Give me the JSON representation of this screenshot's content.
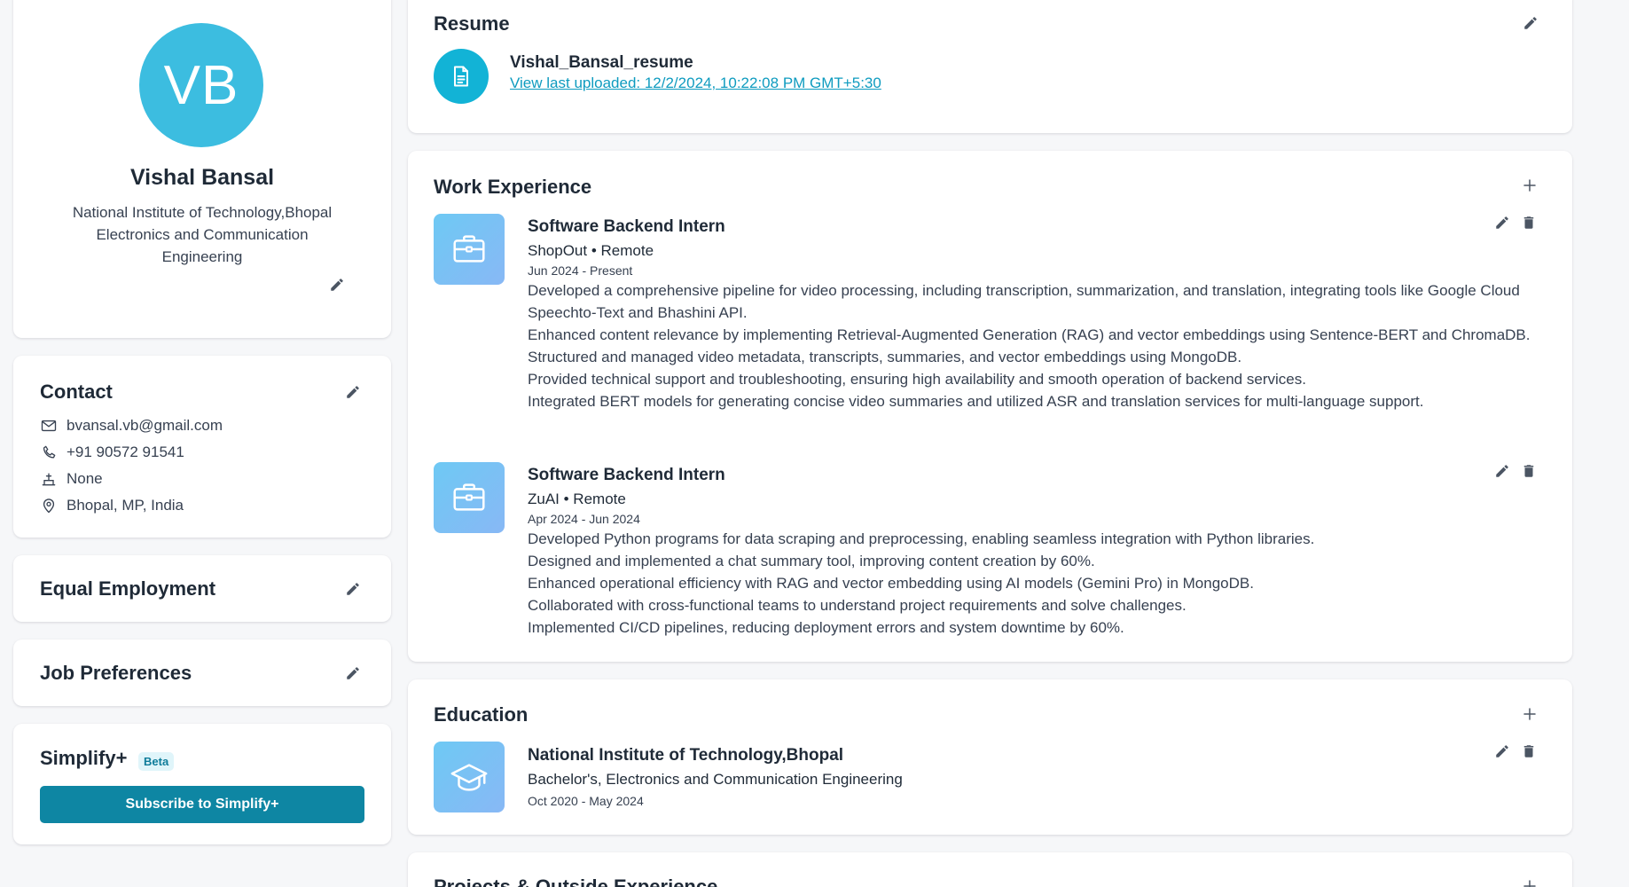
{
  "profile": {
    "initials": "VB",
    "name": "Vishal Bansal",
    "institution": "National Institute of Technology,Bhopal",
    "major": "Electronics and Communication Engineering",
    "avatar_color": "#3cbde0"
  },
  "contact": {
    "title": "Contact",
    "email": "bvansal.vb@gmail.com",
    "phone": "+91 90572 91541",
    "website": "None",
    "location": "Bhopal, MP, India"
  },
  "equal_employment": {
    "title": "Equal Employment"
  },
  "job_preferences": {
    "title": "Job Preferences"
  },
  "simplify": {
    "title": "Simplify+",
    "badge": "Beta",
    "button_label": "Subscribe to Simplify+",
    "button_color": "#0e86a3"
  },
  "resume": {
    "title": "Resume",
    "file_name": "Vishal_Bansal_resume",
    "link_text": "View last uploaded: 12/2/2024, 10:22:08 PM GMT+5:30"
  },
  "work": {
    "title": "Work Experience",
    "items": [
      {
        "title": "Software Backend Intern",
        "company_line": "ShopOut • Remote",
        "dates": "Jun 2024 - Present",
        "bullets": [
          "Developed a comprehensive pipeline for video processing, including transcription, summarization, and translation, integrating tools like Google Cloud Speechto-Text and Bhashini API.",
          "Enhanced content relevance by implementing Retrieval-Augmented Generation (RAG) and vector embeddings using Sentence-BERT and ChromaDB.",
          "Structured and managed video metadata, transcripts, summaries, and vector embeddings using MongoDB.",
          "Provided technical support and troubleshooting, ensuring high availability and smooth operation of backend services.",
          "Integrated BERT models for generating concise video summaries and utilized ASR and translation services for multi-language support."
        ]
      },
      {
        "title": "Software Backend Intern",
        "company_line": "ZuAI • Remote",
        "dates": "Apr 2024 - Jun 2024",
        "bullets": [
          "Developed Python programs for data scraping and preprocessing, enabling seamless integration with Python libraries.",
          "Designed and implemented a chat summary tool, improving content creation by 60%.",
          "Enhanced operational efficiency with RAG and vector embedding using AI models (Gemini Pro) in MongoDB.",
          "Collaborated with cross-functional teams to understand project requirements and solve challenges.",
          "Implemented CI/CD pipelines, reducing deployment errors and system downtime by 60%."
        ]
      }
    ]
  },
  "education": {
    "title": "Education",
    "items": [
      {
        "school": "National Institute of Technology,Bhopal",
        "degree": "Bachelor's, Electronics and Communication Engineering",
        "dates": "Oct 2020 - May 2024"
      }
    ]
  },
  "projects": {
    "title": "Projects & Outside Experience"
  }
}
